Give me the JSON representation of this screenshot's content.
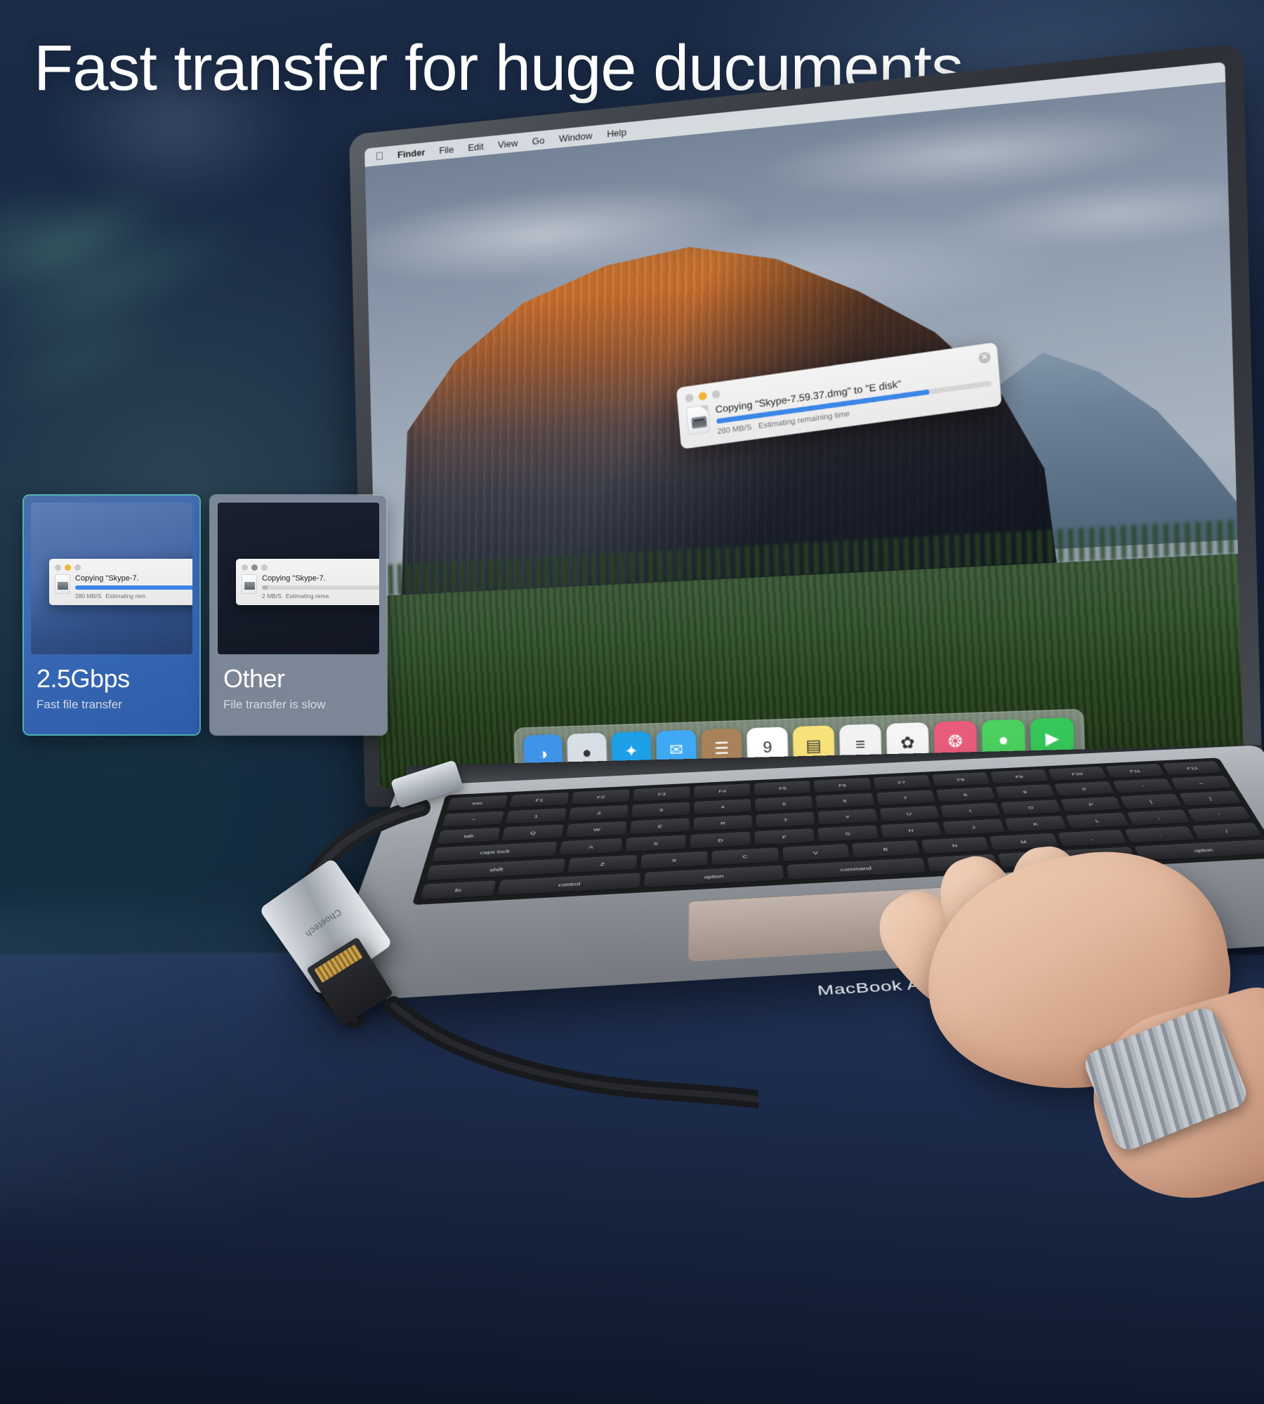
{
  "headline": "Fast transfer for huge ducuments",
  "colors": {
    "accent_blue": "#3b86e8",
    "card_good_border": "#5ac8cd",
    "card_bad_bg": "#7b8696",
    "background_navy": "#14223c",
    "amber_dot": "#f0b433"
  },
  "laptop": {
    "model_label": "MacBook Air",
    "menubar": {
      "apple_icon": "apple-icon",
      "items": [
        "Finder",
        "File",
        "Edit",
        "View",
        "Go",
        "Window",
        "Help"
      ]
    },
    "copy_dialog": {
      "title": "Copying \"Skype-7.59.37.dmg\" to \"E disk\"",
      "speed": "280 MB/S",
      "status": "Estimating remaining time",
      "progress_percent": 78,
      "close_icon": "close-icon",
      "file_icon": "disk-file-icon",
      "traffic_lights": [
        "gray",
        "amber",
        "gray"
      ]
    },
    "dock": {
      "icons": [
        {
          "name": "finder-icon",
          "glyph": "◑",
          "bg": "#3f93e8"
        },
        {
          "name": "launchpad-icon",
          "glyph": "●",
          "bg": "#d8dee6"
        },
        {
          "name": "safari-icon",
          "glyph": "✦",
          "bg": "#1d9fe8"
        },
        {
          "name": "mail-icon",
          "glyph": "✉",
          "bg": "#3fa9f5"
        },
        {
          "name": "contacts-icon",
          "glyph": "☰",
          "bg": "#a9825a"
        },
        {
          "name": "calendar-icon",
          "glyph": "9",
          "bg": "#ffffff"
        },
        {
          "name": "notes-icon",
          "glyph": "▤",
          "bg": "#f7e27a"
        },
        {
          "name": "reminders-icon",
          "glyph": "≡",
          "bg": "#f2f2f2"
        },
        {
          "name": "photos-icon",
          "glyph": "✿",
          "bg": "#f5f5f5"
        },
        {
          "name": "photobooth-icon",
          "glyph": "❂",
          "bg": "#e85c7a"
        },
        {
          "name": "messages-icon",
          "glyph": "●",
          "bg": "#4ad15e"
        },
        {
          "name": "facetime-icon",
          "glyph": "▶",
          "bg": "#35c759"
        }
      ]
    },
    "keyboard_rows": [
      [
        "esc",
        "F1",
        "F2",
        "F3",
        "F4",
        "F5",
        "F6",
        "F7",
        "F8",
        "F9",
        "F10",
        "F11",
        "F12"
      ],
      [
        "~",
        "1",
        "2",
        "3",
        "4",
        "5",
        "6",
        "7",
        "8",
        "9",
        "0",
        "-",
        "="
      ],
      [
        "tab",
        "Q",
        "W",
        "E",
        "R",
        "T",
        "Y",
        "U",
        "I",
        "O",
        "P",
        "[",
        "]"
      ],
      [
        "caps lock",
        "A",
        "S",
        "D",
        "F",
        "G",
        "H",
        "J",
        "K",
        "L",
        ";",
        "'"
      ],
      [
        "shift",
        "Z",
        "X",
        "C",
        "V",
        "B",
        "N",
        "M",
        ",",
        ".",
        "/"
      ],
      [
        "fn",
        "control",
        "option",
        "command",
        "",
        "command",
        "option"
      ]
    ]
  },
  "adapter": {
    "brand": "Choetech",
    "usbc_connector": "usb-c-connector",
    "rj45_connector": "rj45-ethernet-connector"
  },
  "cards": [
    {
      "id": "good",
      "title": "2.5Gbps",
      "subtitle": "Fast file transfer",
      "dialog": {
        "title": "Copying \"Skype-7.",
        "speed": "280 MB/S",
        "status": "Estimating rem",
        "progress_percent": 96,
        "progress_color": "#3b86e8",
        "traffic_lights": [
          "gray",
          "amber",
          "gray"
        ]
      }
    },
    {
      "id": "bad",
      "title": "Other",
      "subtitle": "File transfer is slow",
      "dialog": {
        "title": "Copying \"Skype-7.",
        "speed": "2 MB/S",
        "status": "Estimating rema",
        "progress_percent": 4,
        "progress_color": "#b3b3b3",
        "traffic_lights": [
          "gray",
          "darkgray",
          "gray"
        ]
      }
    }
  ]
}
